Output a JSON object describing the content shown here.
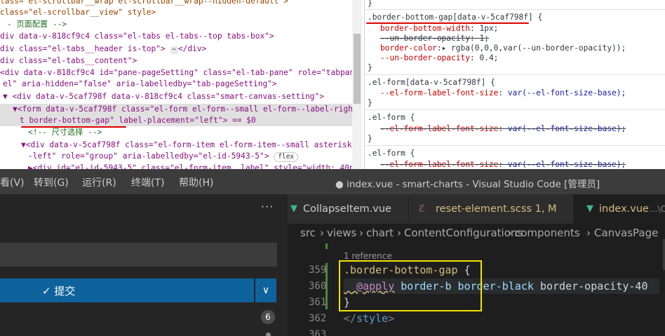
{
  "devtools": {
    "elements": {
      "lines": [
        {
          "indent": "",
          "text": "lass= el-scrollbar__wrap el-scrollbar__wrap--hidden-default >"
        },
        {
          "indent": "",
          "text": "class=\"el-scrollbar__view\" style>"
        },
        {
          "indent": "",
          "text": "- 页面配置 -->"
        },
        {
          "indent": "",
          "text": "div data-v-818cf9c4 class=\"el-tabs el-tabs--top tabs-box\">"
        },
        {
          "indent": "",
          "text": "div class=\"el-tabs__header is-top\">"
        },
        {
          "indent": "",
          "text": "div class=\"el-tabs__content\">"
        },
        {
          "indent": "",
          "text": "<div data-v-818cf9c4 id=\"pane-pageSetting\" class=\"el-tab-pane\" role=\"tabpan"
        },
        {
          "indent": "",
          "text": "el\" aria-hidden=\"false\" aria-labelledby=\"tab-pageSetting\">"
        },
        {
          "indent": "",
          "text": "▼ <div data-v-5caf798f data-v-818cf9c4 class=\"smart-canvas-setting\">"
        },
        {
          "indent": "",
          "text": "▼<form data-v-5caf798f class=\"el-form el-form--small el-form--label-righ"
        },
        {
          "indent": "",
          "text": "t border-bottom-gap\" label-placement=\"left\"> == $0"
        },
        {
          "indent": "",
          "text": "<!-- 尺寸选择 -->"
        },
        {
          "indent": "",
          "text": "▼<div data-v-5caf798f class=\"el-form-item el-form-item--small asterisk"
        },
        {
          "indent": "",
          "text": "-left\" role=\"group\" aria-labelledby=\"el-id-5943-5\">"
        },
        {
          "indent": "",
          "text": "▶<div id=\"el-id-5943-5\" class=\"el-form-item__label\" style=\"width: 40p"
        }
      ],
      "ellipsis": "⋯",
      "flex_badge": "flex",
      "selected_marker": "== $0"
    },
    "styles": {
      "rules": [
        {
          "selector": ".border-bottom-gap[data-v-5caf798f] {",
          "props": [
            {
              "name": "border-bottom-width",
              "value": "1px;",
              "struck": false
            },
            {
              "name": "--un-border-opacity",
              "value": "1;",
              "struck": true
            },
            {
              "name": "border-color",
              "value": "rgba(0,0,0,var(--un-border-opacity));",
              "struck": false
            },
            {
              "name": "--un-border-opacity",
              "value": "0.4;",
              "struck": false
            }
          ]
        },
        {
          "selector": ".el-form[data-v-5caf798f] {",
          "props": [
            {
              "name": "--el-form-label-font-size",
              "value": "var(--el-font-size-base);",
              "struck": false
            }
          ]
        },
        {
          "selector": ".el-form {",
          "props": [
            {
              "name": "--el-form-label-font-size",
              "value": "var(--el-font-size-base);",
              "struck": true
            }
          ]
        },
        {
          "selector": ".el-form {",
          "props": [
            {
              "name": "--el-form-label-font-size",
              "value": "var(--el-font-size-base);",
              "struck": true
            }
          ]
        }
      ],
      "top_brace": "}",
      "close_brace": "}"
    }
  },
  "vscode": {
    "menu": [
      "看(V)",
      "转到(G)",
      "运行(R)",
      "终端(T)",
      "帮助(H)"
    ],
    "window_title": "● index.vue - smart-charts - Visual Studio Code [管理员]",
    "sidebar": {
      "more_label": "···",
      "commit_label": "✓ 提交",
      "dropdown_label": "∨",
      "changes_count": "6"
    },
    "tabs": [
      {
        "label": "CollapseItem.vue",
        "icon": "vue-icon",
        "color": "#cccccc",
        "active": false
      },
      {
        "label": "reset-element.scss 1, M",
        "icon": "scss-icon",
        "color": "#d7ba7d",
        "active": false
      },
      {
        "label": "index.vue",
        "suffix": "...\\C",
        "icon": "vue-icon",
        "color": "#d7ba7d",
        "active": true
      }
    ],
    "breadcrumbs": [
      "src",
      "views",
      "chart",
      "ContentConfigurations",
      "components",
      "CanvasPage"
    ],
    "codelens": "1 reference",
    "code": [
      {
        "num": "359",
        "parts": [
          {
            "t": ".border-bottom-gap",
            "c": "c-sel"
          },
          {
            "t": " {",
            "c": "c-brace"
          }
        ]
      },
      {
        "num": "360",
        "parts": [
          {
            "t": "  @apply",
            "c": "c-at"
          },
          {
            "t": " border-b border-black ",
            "c": "c-kw"
          },
          {
            "t": "border-opacity-40",
            "c": "c-brace"
          }
        ]
      },
      {
        "num": "361",
        "parts": [
          {
            "t": "}",
            "c": "c-brace"
          }
        ]
      },
      {
        "num": "362",
        "parts": [
          {
            "t": "</",
            "c": "c-tag"
          },
          {
            "t": "style",
            "c": "c-tagname"
          },
          {
            "t": ">",
            "c": "c-tag"
          }
        ]
      },
      {
        "num": "363",
        "parts": []
      }
    ],
    "colors": {
      "highlight_box": "#f5e000",
      "red_mark": "#e00000",
      "button": "#0e639c",
      "vue": "#41b883",
      "scss": "#cd6799"
    }
  }
}
